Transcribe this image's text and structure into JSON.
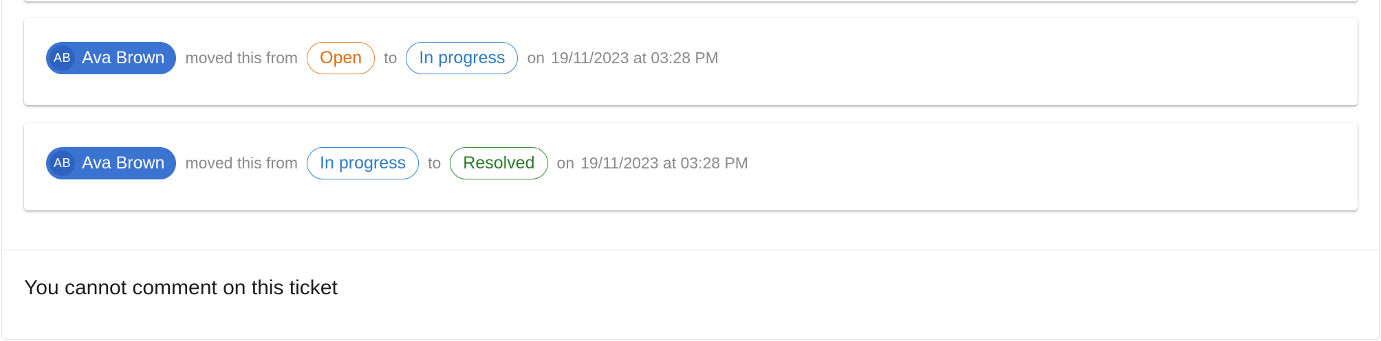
{
  "history": [
    {
      "user_initials": "AB",
      "user_name": "Ava Brown",
      "moved_text": "moved this from",
      "from_status": "Open",
      "to_text": "to",
      "to_status": "In progress",
      "on_text": "on",
      "timestamp": "19/11/2023 at 03:28 PM"
    },
    {
      "user_initials": "AB",
      "user_name": "Ava Brown",
      "moved_text": "moved this from",
      "from_status": "In progress",
      "to_text": "to",
      "to_status": "Resolved",
      "on_text": "on",
      "timestamp": "19/11/2023 at 03:28 PM"
    }
  ],
  "footer": {
    "message": "You cannot comment on this ticket"
  },
  "colors": {
    "user_chip": "#3b73d1",
    "open": "#db6c12",
    "in_progress": "#2f7bc7",
    "resolved": "#2b7a2b"
  }
}
